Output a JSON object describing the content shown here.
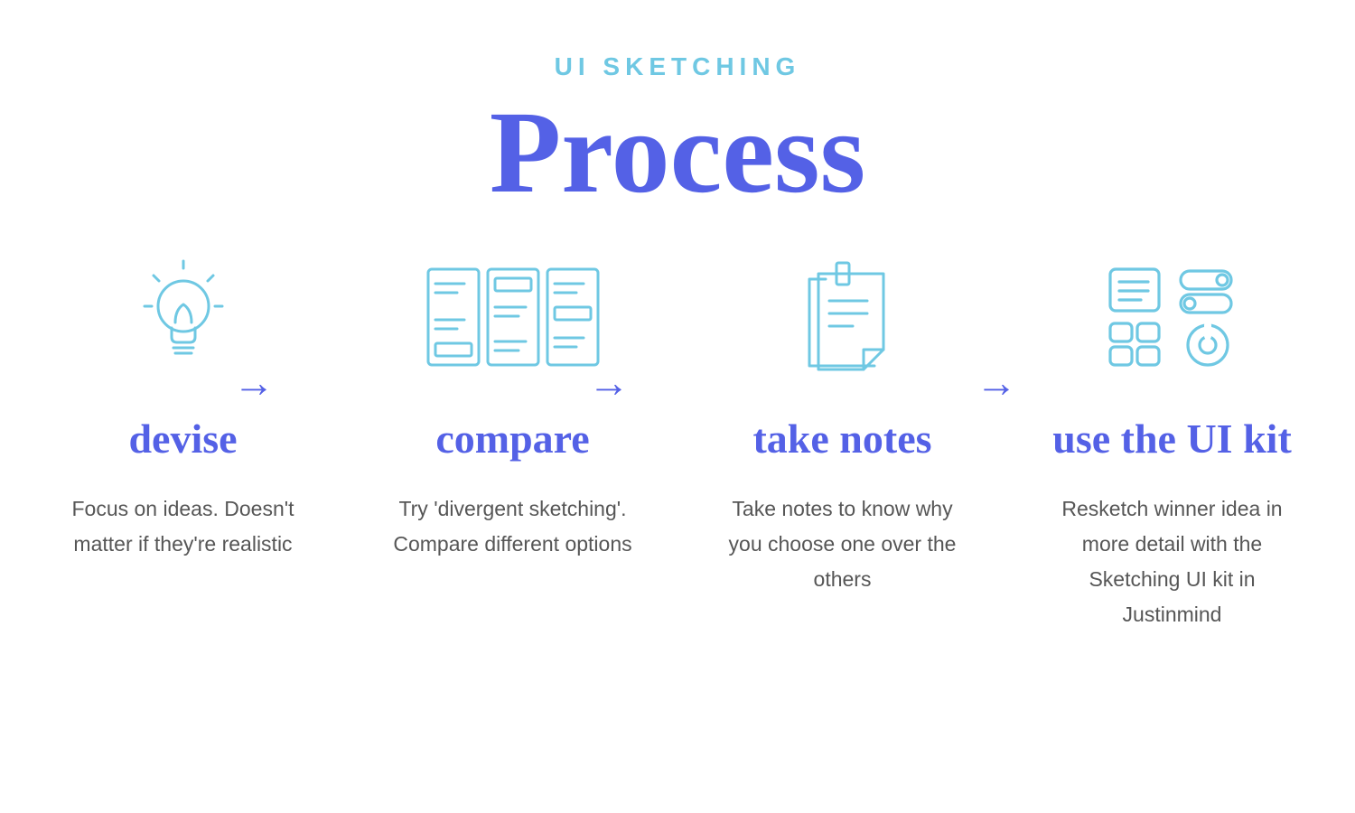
{
  "header": {
    "eyebrow": "UI SKETCHING",
    "title": "Process"
  },
  "steps": [
    {
      "icon": "lightbulb-icon",
      "title": "devise",
      "description": "Focus on ideas. Doesn't matter if they're realistic"
    },
    {
      "icon": "wireframes-icon",
      "title": "compare",
      "description": "Try 'divergent sketching'. Compare different options"
    },
    {
      "icon": "note-icon",
      "title": "take notes",
      "description": "Take notes to know why you choose one over the others"
    },
    {
      "icon": "uikit-icon",
      "title": "use the UI kit",
      "description": "Resketch winner idea in more detail with the Sketching UI kit in Justinmind"
    }
  ],
  "colors": {
    "accent_light": "#6fc8e3",
    "accent": "#5461e6",
    "body_text": "#565656"
  },
  "arrow_glyph": "→"
}
